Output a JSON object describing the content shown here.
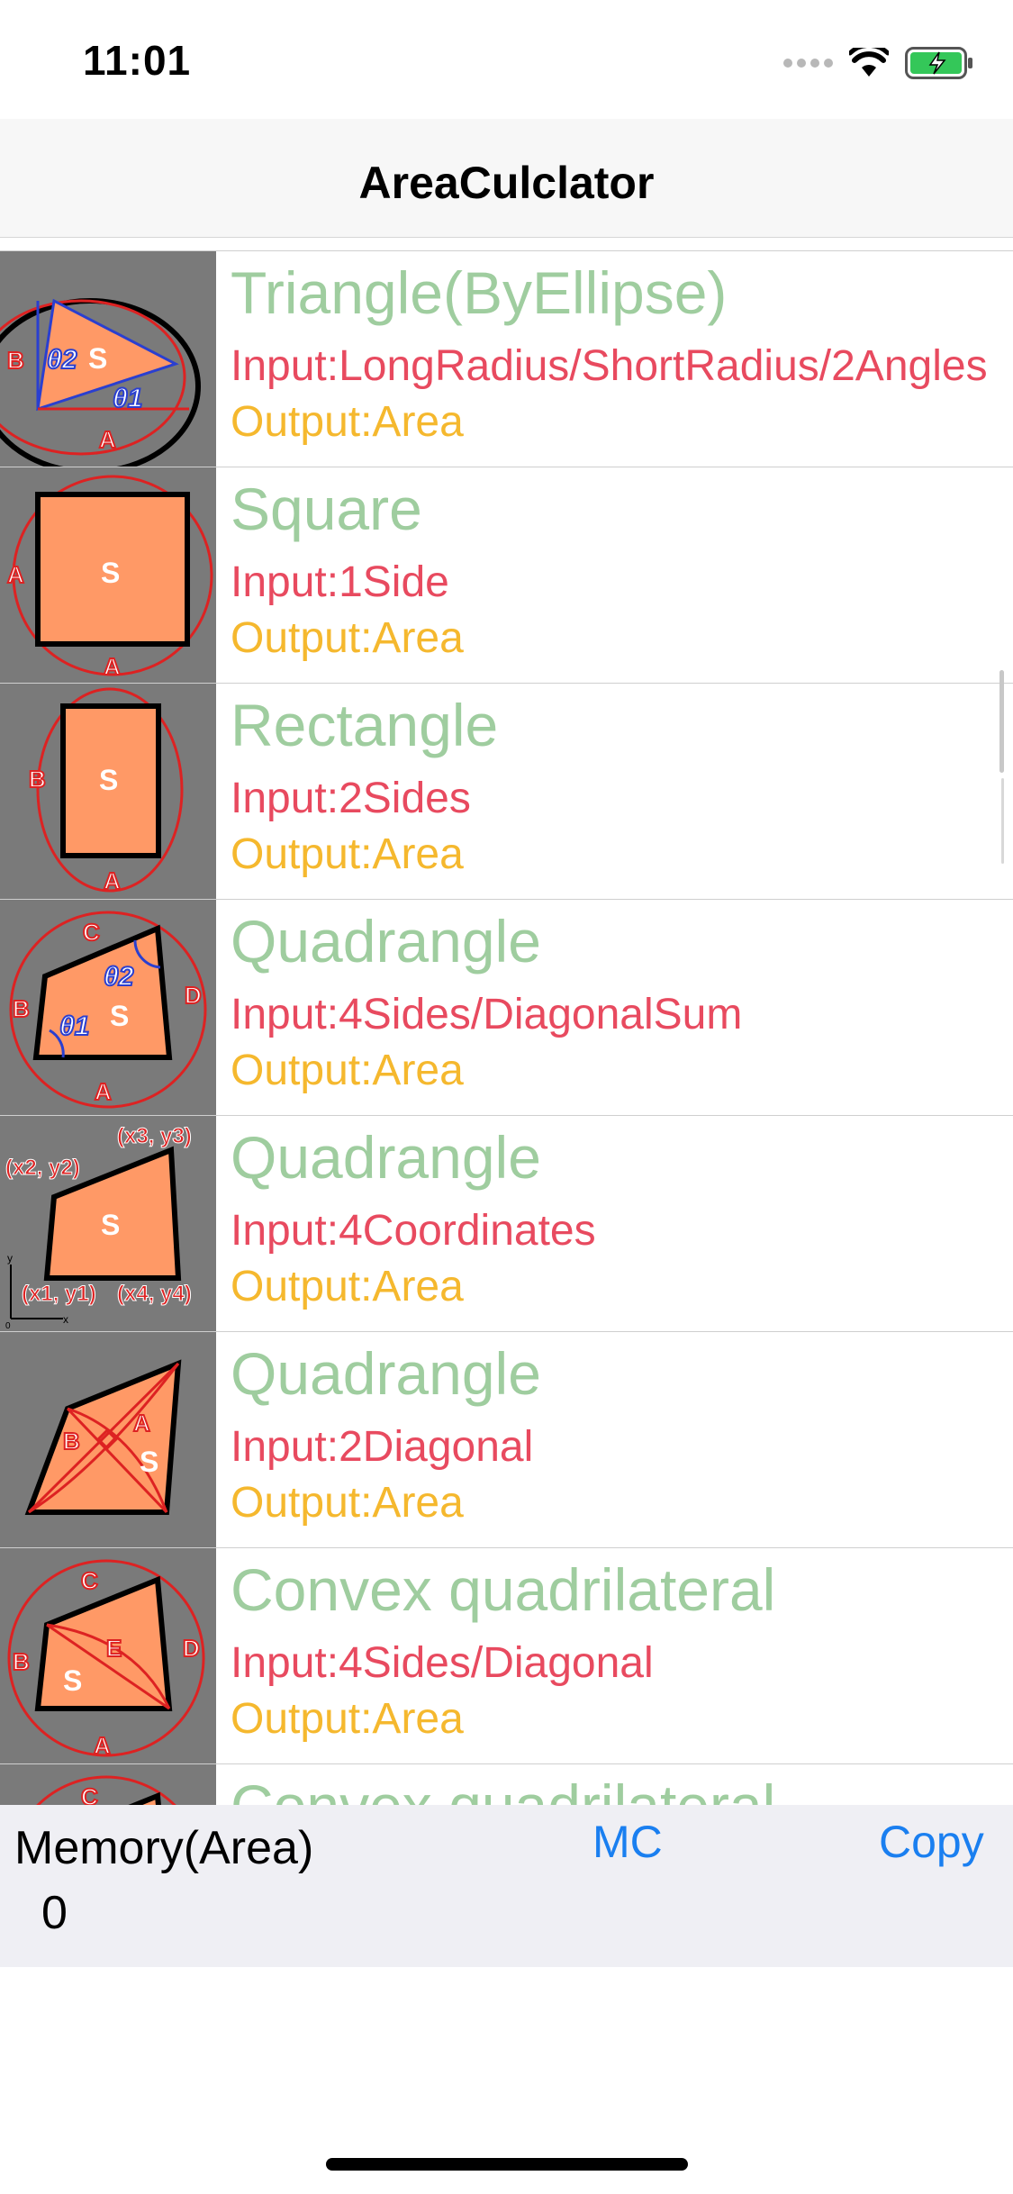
{
  "status_bar": {
    "time": "11:01"
  },
  "nav": {
    "title": "AreaCulclator"
  },
  "list": {
    "items": [
      {
        "title": "Triangle(ByEllipse)",
        "input": "Input:LongRadius/ShortRadius/2Angles",
        "output": "Output:Area",
        "icon": "triangle-ellipse"
      },
      {
        "title": "Square",
        "input": "Input:1Side",
        "output": "Output:Area",
        "icon": "square"
      },
      {
        "title": "Rectangle",
        "input": "Input:2Sides",
        "output": "Output:Area",
        "icon": "rectangle"
      },
      {
        "title": "Quadrangle",
        "input": "Input:4Sides/DiagonalSum",
        "output": "Output:Area",
        "icon": "quadrangle-angles"
      },
      {
        "title": "Quadrangle",
        "input": "Input:4Coordinates",
        "output": "Output:Area",
        "icon": "quadrangle-coordinates"
      },
      {
        "title": "Quadrangle",
        "input": "Input:2Diagonal",
        "output": "Output:Area",
        "icon": "quadrangle-diagonals"
      },
      {
        "title": "Convex quadrilateral",
        "input": "Input:4Sides/Diagonal",
        "output": "Output:Area",
        "icon": "convex-quadrilateral"
      },
      {
        "title": "Convex quadrilateral",
        "input": "",
        "output": "",
        "icon": "convex-quadrilateral-partial"
      }
    ]
  },
  "diagram_labels": {
    "a": "A",
    "b": "B",
    "c": "C",
    "d": "D",
    "e": "E",
    "s": "S",
    "theta1": "θ1",
    "theta2": "θ2",
    "p1": "(x1, y1)",
    "p2": "(x2, y2)",
    "p3": "(x3, y3)",
    "p4": "(x4, y4)",
    "axis_x": "x",
    "axis_y": "y",
    "origin": "0"
  },
  "memory": {
    "label": "Memory(Area)",
    "value": "0",
    "mc_label": "MC",
    "copy_label": "Copy"
  },
  "colors": {
    "title": "#9fcd9f",
    "input": "#e84a5f",
    "output": "#f5b82e",
    "accent": "#1a7ff0",
    "shape_fill": "#ff9966",
    "thumb_bg": "#7a7a7a"
  }
}
